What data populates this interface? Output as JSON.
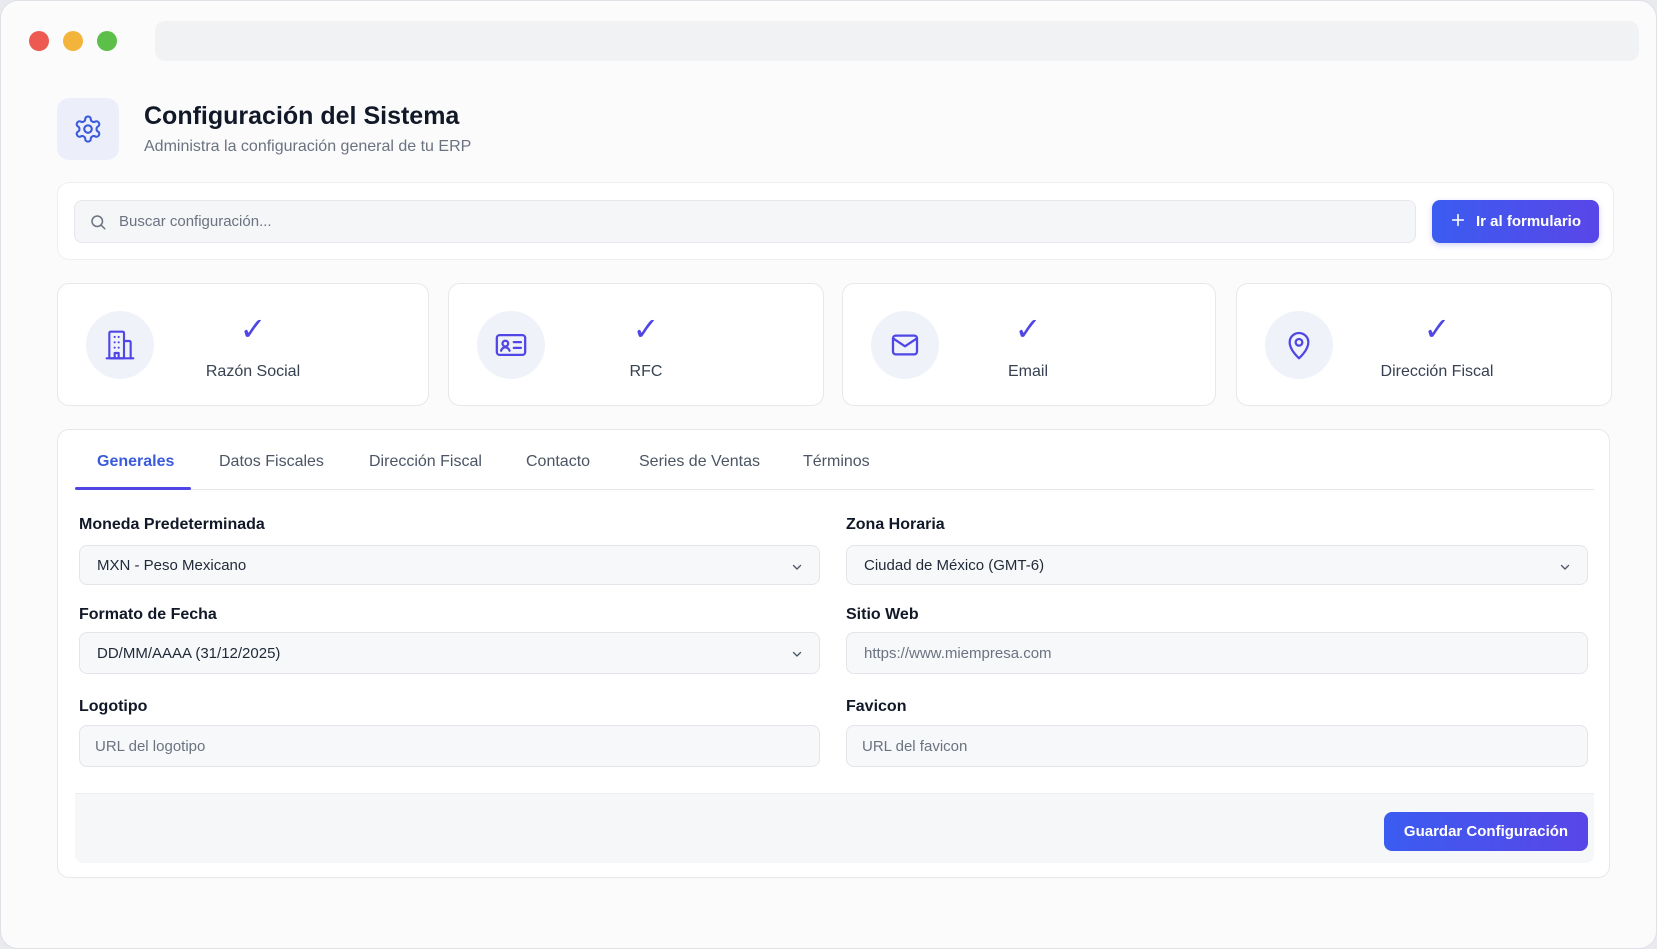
{
  "header": {
    "title": "Configuración del Sistema",
    "subtitle": "Administra la configuración general de tu ERP"
  },
  "search": {
    "placeholder": "Buscar configuración...",
    "button_label": "Ir al formulario"
  },
  "status_cards": [
    {
      "label": "Razón Social",
      "icon": "building-icon",
      "check": "✓"
    },
    {
      "label": "RFC",
      "icon": "id-card-icon",
      "check": "✓"
    },
    {
      "label": "Email",
      "icon": "mail-icon",
      "check": "✓"
    },
    {
      "label": "Dirección Fiscal",
      "icon": "map-pin-icon",
      "check": "✓"
    }
  ],
  "tabs": [
    {
      "label": "Generales",
      "active": true
    },
    {
      "label": "Datos Fiscales"
    },
    {
      "label": "Dirección Fiscal"
    },
    {
      "label": "Contacto"
    },
    {
      "label": "Series de Ventas"
    },
    {
      "label": "Términos"
    }
  ],
  "form": {
    "currency": {
      "label": "Moneda Predeterminada",
      "value": "MXN - Peso Mexicano"
    },
    "timezone": {
      "label": "Zona Horaria",
      "value": "Ciudad de México (GMT-6)"
    },
    "date_format": {
      "label": "Formato de Fecha",
      "value": "DD/MM/AAAA (31/12/2025)"
    },
    "website": {
      "label": "Sitio Web",
      "placeholder": "https://www.miempresa.com"
    },
    "logo": {
      "label": "Logotipo",
      "placeholder": "URL del logotipo"
    },
    "favicon": {
      "label": "Favicon",
      "placeholder": "URL del favicon"
    },
    "save_label": "Guardar Configuración"
  },
  "colors": {
    "accent": "#4f46e5",
    "accent_start": "#3b5cf0",
    "accent_end": "#5946e8"
  }
}
